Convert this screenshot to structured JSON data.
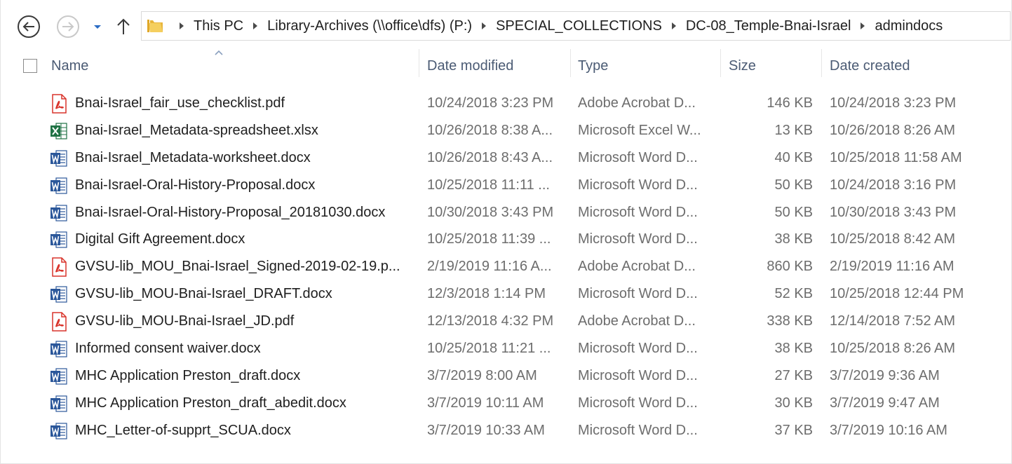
{
  "address_bar": {
    "crumbs": [
      "This PC",
      "Library-Archives (\\\\office\\dfs) (P:)",
      "SPECIAL_COLLECTIONS",
      "DC-08_Temple-Bnai-Israel",
      "admindocs"
    ]
  },
  "columns": {
    "name": "Name",
    "date_modified": "Date modified",
    "type": "Type",
    "size": "Size",
    "date_created": "Date created"
  },
  "files": [
    {
      "icon": "pdf-icon",
      "name": "Bnai-Israel_fair_use_checklist.pdf",
      "date_modified": "10/24/2018 3:23 PM",
      "type": "Adobe Acrobat D...",
      "size": "146 KB",
      "date_created": "10/24/2018 3:23 PM"
    },
    {
      "icon": "excel-icon",
      "name": "Bnai-Israel_Metadata-spreadsheet.xlsx",
      "date_modified": "10/26/2018 8:38 A...",
      "type": "Microsoft Excel W...",
      "size": "13 KB",
      "date_created": "10/26/2018 8:26 AM"
    },
    {
      "icon": "word-icon",
      "name": "Bnai-Israel_Metadata-worksheet.docx",
      "date_modified": "10/26/2018 8:43 A...",
      "type": "Microsoft Word D...",
      "size": "40 KB",
      "date_created": "10/25/2018 11:58 AM"
    },
    {
      "icon": "word-icon",
      "name": "Bnai-Israel-Oral-History-Proposal.docx",
      "date_modified": "10/25/2018 11:11 ...",
      "type": "Microsoft Word D...",
      "size": "50 KB",
      "date_created": "10/24/2018 3:16 PM"
    },
    {
      "icon": "word-icon",
      "name": "Bnai-Israel-Oral-History-Proposal_20181030.docx",
      "date_modified": "10/30/2018 3:43 PM",
      "type": "Microsoft Word D...",
      "size": "50 KB",
      "date_created": "10/30/2018 3:43 PM"
    },
    {
      "icon": "word-icon",
      "name": "Digital Gift Agreement.docx",
      "date_modified": "10/25/2018 11:39 ...",
      "type": "Microsoft Word D...",
      "size": "38 KB",
      "date_created": "10/25/2018 8:42 AM"
    },
    {
      "icon": "pdf-icon",
      "name": "GVSU-lib_MOU_Bnai-Israel_Signed-2019-02-19.p...",
      "date_modified": "2/19/2019 11:16 A...",
      "type": "Adobe Acrobat D...",
      "size": "860 KB",
      "date_created": "2/19/2019 11:16 AM"
    },
    {
      "icon": "word-icon",
      "name": "GVSU-lib_MOU-Bnai-Israel_DRAFT.docx",
      "date_modified": "12/3/2018 1:14 PM",
      "type": "Microsoft Word D...",
      "size": "52 KB",
      "date_created": "10/25/2018 12:44 PM"
    },
    {
      "icon": "pdf-icon",
      "name": "GVSU-lib_MOU-Bnai-Israel_JD.pdf",
      "date_modified": "12/13/2018 4:32 PM",
      "type": "Adobe Acrobat D...",
      "size": "338 KB",
      "date_created": "12/14/2018 7:52 AM"
    },
    {
      "icon": "word-icon",
      "name": "Informed consent waiver.docx",
      "date_modified": "10/25/2018 11:21 ...",
      "type": "Microsoft Word D...",
      "size": "38 KB",
      "date_created": "10/25/2018 8:26 AM"
    },
    {
      "icon": "word-icon",
      "name": "MHC Application Preston_draft.docx",
      "date_modified": "3/7/2019 8:00 AM",
      "type": "Microsoft Word D...",
      "size": "27 KB",
      "date_created": "3/7/2019 9:36 AM"
    },
    {
      "icon": "word-icon",
      "name": "MHC Application Preston_draft_abedit.docx",
      "date_modified": "3/7/2019 10:11 AM",
      "type": "Microsoft Word D...",
      "size": "30 KB",
      "date_created": "3/7/2019 9:47 AM"
    },
    {
      "icon": "word-icon",
      "name": "MHC_Letter-of-supprt_SCUA.docx",
      "date_modified": "3/7/2019 10:33 AM",
      "type": "Microsoft Word D...",
      "size": "37 KB",
      "date_created": "3/7/2019 10:16 AM"
    }
  ],
  "colors": {
    "header_text": "#4b5b74",
    "pdf_red": "#d9342b",
    "excel_green": "#1f7244",
    "word_blue": "#2b579a",
    "folder_yellow": "#e8b53a"
  }
}
